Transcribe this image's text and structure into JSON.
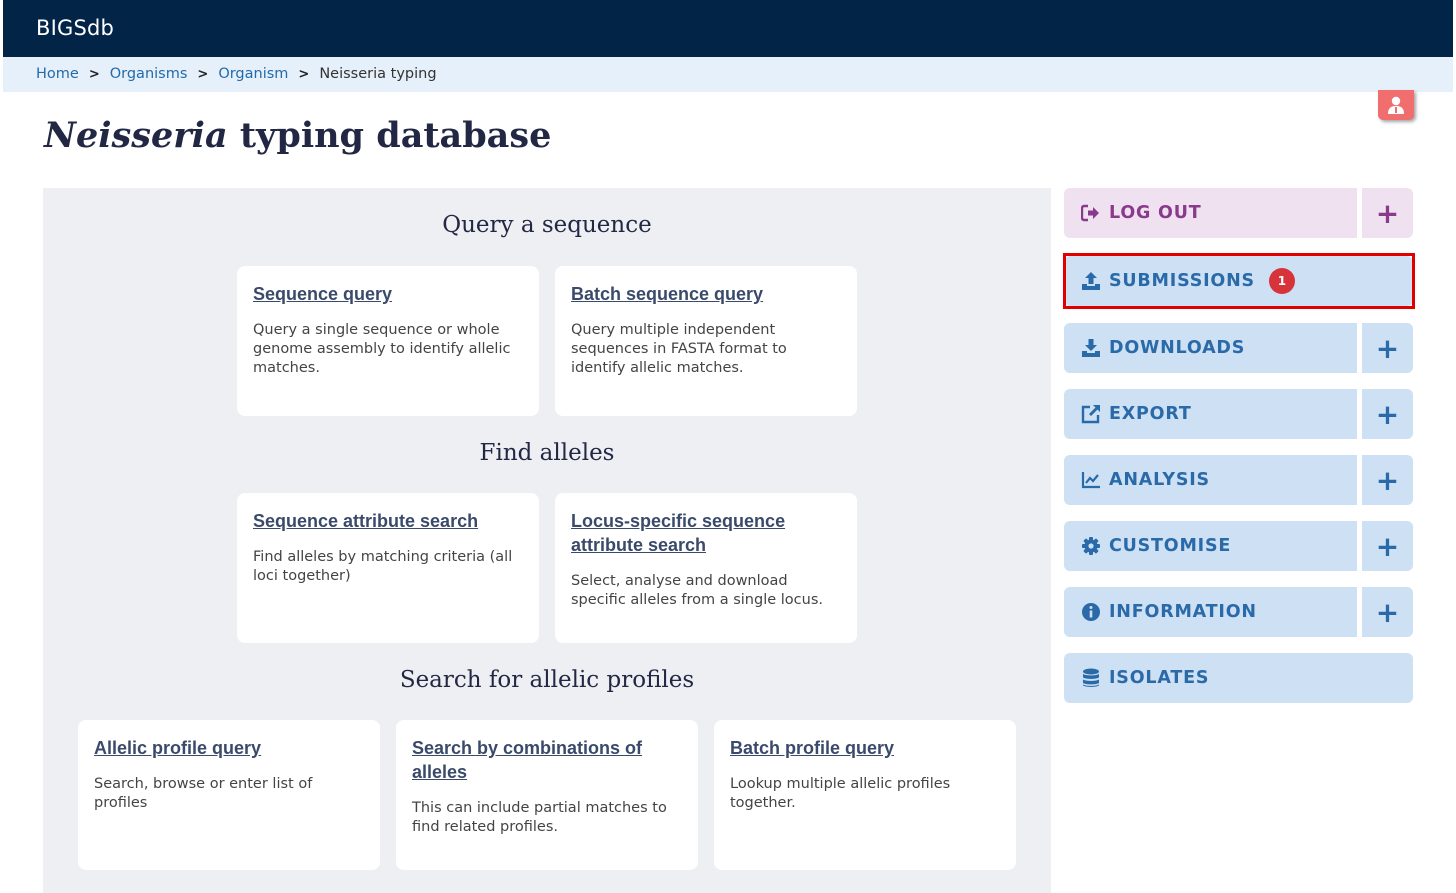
{
  "header": {
    "brand": "BIGSdb"
  },
  "breadcrumb": {
    "home": "Home",
    "organisms": "Organisms",
    "organism": "Organism",
    "current": "Neisseria typing",
    "separator": ">"
  },
  "title": {
    "italic": "Neisseria",
    "rest": " typing database"
  },
  "sections": {
    "query": {
      "title": "Query a sequence",
      "cards": [
        {
          "link": "Sequence query",
          "desc": "Query a single sequence or whole genome assembly to identify allelic matches."
        },
        {
          "link": "Batch sequence query",
          "desc": "Query multiple independent sequences in FASTA format to identify allelic matches."
        }
      ]
    },
    "alleles": {
      "title": "Find alleles",
      "cards": [
        {
          "link": "Sequence attribute search",
          "desc": "Find alleles by matching criteria (all loci together)"
        },
        {
          "link": "Locus-specific sequence attribute search",
          "desc": "Select, analyse and download specific alleles from a single locus."
        }
      ]
    },
    "profiles": {
      "title": "Search for allelic profiles",
      "cards": [
        {
          "link": "Allelic profile query",
          "desc": "Search, browse or enter list of profiles"
        },
        {
          "link": "Search by combinations of alleles",
          "desc": "This can include partial matches to find related profiles."
        },
        {
          "link": "Batch profile query",
          "desc": "Lookup multiple allelic profiles together."
        }
      ]
    }
  },
  "sidebar": {
    "plus": "+",
    "logout": "LOG OUT",
    "submissions": "SUBMISSIONS",
    "submissions_count": "1",
    "downloads": "DOWNLOADS",
    "export": "EXPORT",
    "analysis": "ANALYSIS",
    "customise": "CUSTOMISE",
    "information": "INFORMATION",
    "isolates": "ISOLATES"
  },
  "colors": {
    "topbar": "#022447",
    "accent_blue": "#2a6aa8",
    "logout_purple": "#8a3a8c",
    "badge_red": "#d6343a",
    "highlight_red": "#e00000"
  },
  "icons": {
    "user": "user-icon",
    "logout": "sign-out-icon",
    "submissions": "upload-icon",
    "downloads": "download-icon",
    "export": "external-link-icon",
    "analysis": "chart-line-icon",
    "customise": "gear-icon",
    "information": "info-circle-icon",
    "isolates": "database-icon"
  }
}
